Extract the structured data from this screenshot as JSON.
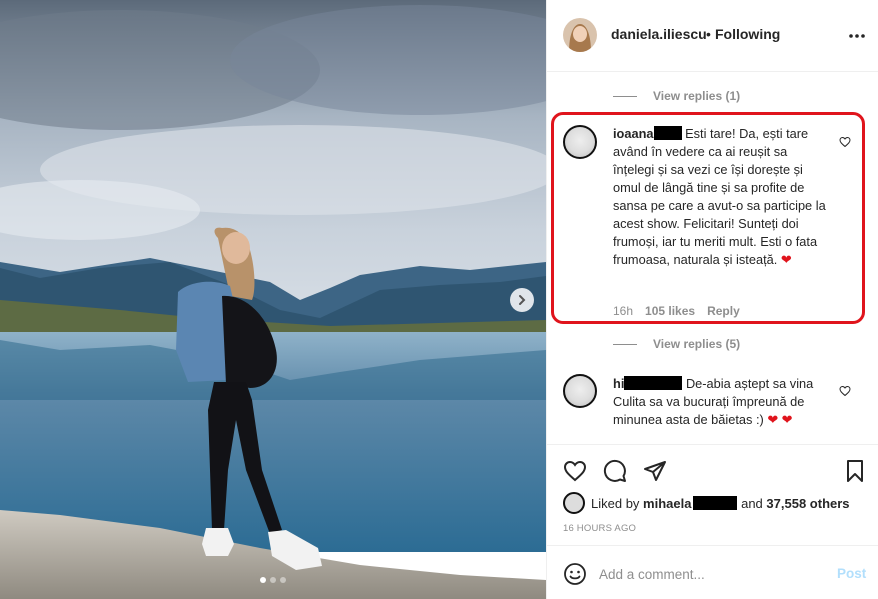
{
  "post": {
    "username": "daniela.iliescu",
    "separator": "•",
    "follow_status": "Following",
    "likes_prefix": "Liked by",
    "liked_by_user": "mihaela",
    "likes_suffix_and": "and",
    "others_count": "37,558 others",
    "timestamp": "16 HOURS AGO",
    "carousel": {
      "slides": 3,
      "active_index": 0
    }
  },
  "comments": [
    {
      "view_replies": "View replies (1)"
    },
    {
      "username": "ioaana",
      "text_before_emoji": "Esti tare! Da, ești tare având în vedere ca ai reușit sa înțelegi și sa vezi ce își dorește și omul de lângă tine și sa profite de sansa pe care a avut-o sa participe la acest show. Felicitari! Sunteți doi frumoși, iar tu meriti mult. Esti o fata frumoasa, naturala și isteață.",
      "emoji": "❤",
      "age": "16h",
      "likes": "105 likes",
      "reply": "Reply",
      "view_replies": "View replies (5)"
    },
    {
      "username": "hi",
      "text": "De-abia aștept sa vina Culita sa va bucurați împreună de minunea asta de băietas :)",
      "emoji": "❤ ❤"
    }
  ],
  "add_comment": {
    "placeholder": "Add a comment...",
    "post_label": "Post"
  },
  "colors": {
    "highlight": "#e0141c",
    "post_disabled": "#b2dffc",
    "heart": "#ed4956"
  },
  "icons": [
    "heart-icon",
    "comment-icon",
    "share-icon",
    "bookmark-icon",
    "emoji-icon",
    "more-icon",
    "chevron-right-icon"
  ]
}
